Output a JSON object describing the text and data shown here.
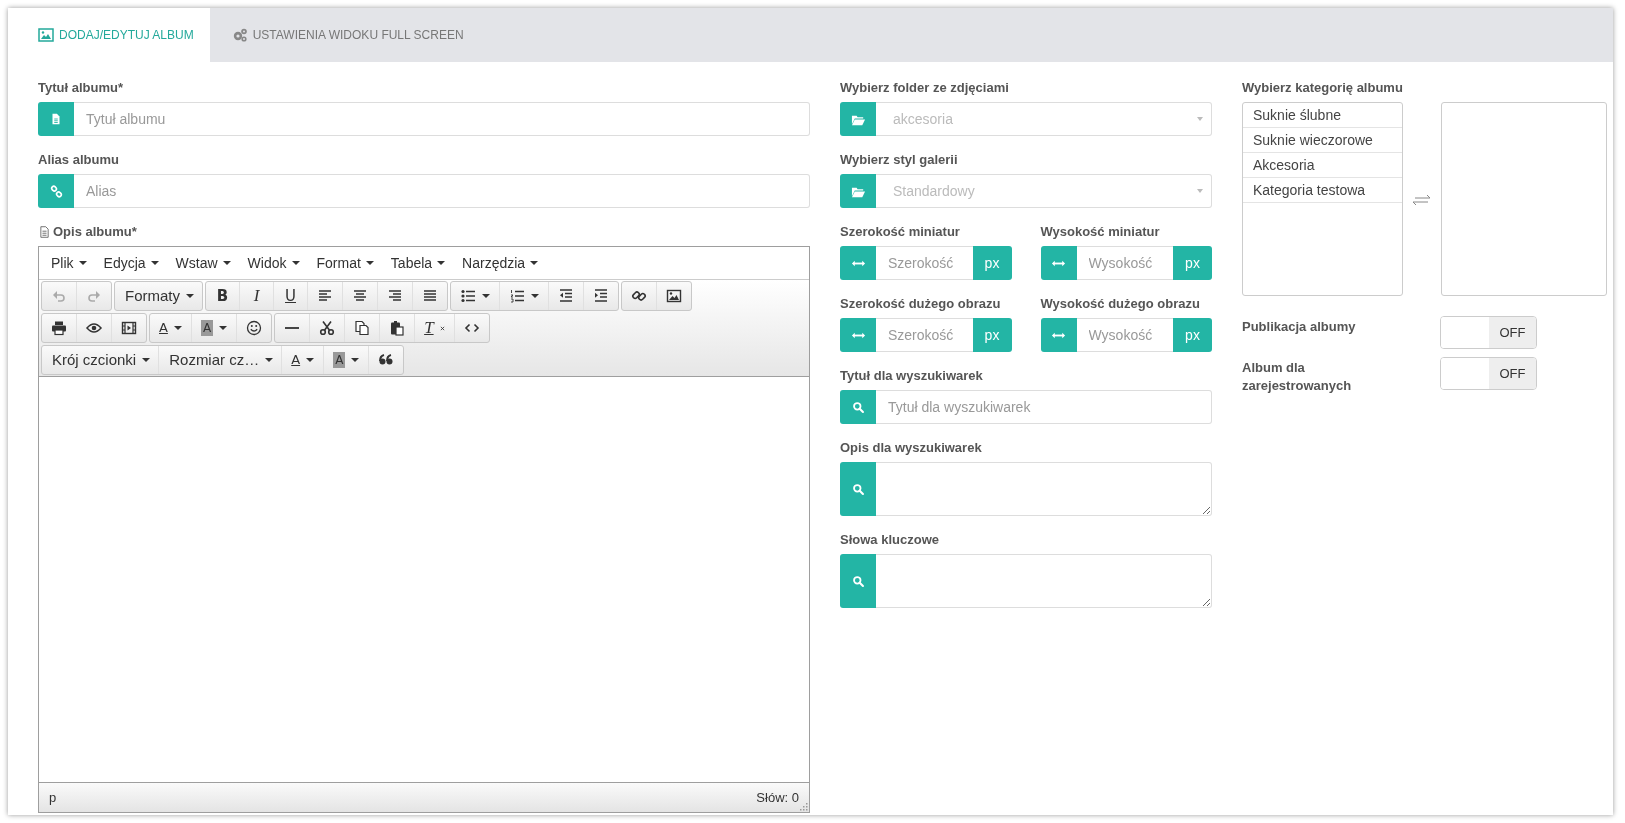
{
  "tabs": [
    {
      "label": "DODAJ/EDYTUJ ALBUM",
      "selected": true
    },
    {
      "label": "USTAWIENIA WIDOKU FULL SCREEN",
      "selected": false
    }
  ],
  "left": {
    "fields": [
      {
        "label": "Tytuł albumu*",
        "placeholder": "Tytuł albumu"
      },
      {
        "label": "Alias albumu",
        "placeholder": "Alias"
      }
    ],
    "editor": {
      "label": "Opis albumu*",
      "menu": [
        "Plik",
        "Edycja",
        "Wstaw",
        "Widok",
        "Format",
        "Tabela",
        "Narzędzia"
      ],
      "toolbar": [
        [
          [
            {
              "kind": "undo",
              "disabled": true
            },
            {
              "kind": "redo",
              "disabled": true
            }
          ],
          [
            {
              "kind": "dropdown",
              "text": "Formaty",
              "disabled": false
            }
          ],
          [
            {
              "kind": "bold",
              "text": "B",
              "disabled": false
            },
            {
              "kind": "italic",
              "text": "I",
              "disabled": false
            },
            {
              "kind": "underline",
              "text": "U",
              "disabled": false
            },
            {
              "kind": "align-left",
              "disabled": false
            },
            {
              "kind": "align-center",
              "disabled": false
            },
            {
              "kind": "align-right",
              "disabled": false
            },
            {
              "kind": "justify",
              "disabled": false
            }
          ],
          [
            {
              "kind": "bullet-list",
              "disabled": false
            },
            {
              "kind": "numbered-list",
              "disabled": false
            },
            {
              "kind": "outdent",
              "disabled": false
            },
            {
              "kind": "indent",
              "disabled": false
            }
          ],
          [
            {
              "kind": "link",
              "disabled": false
            },
            {
              "kind": "image",
              "disabled": false
            }
          ]
        ],
        [
          [
            {
              "kind": "print",
              "disabled": false
            },
            {
              "kind": "preview",
              "disabled": false
            },
            {
              "kind": "media",
              "disabled": false
            }
          ],
          [
            {
              "kind": "text-color",
              "text": "A",
              "disabled": false
            },
            {
              "kind": "background-color",
              "text": "A",
              "disabled": false
            },
            {
              "kind": "emoticon",
              "disabled": false
            }
          ],
          [
            {
              "kind": "horizontal-rule",
              "disabled": false
            },
            {
              "kind": "cut",
              "disabled": false
            },
            {
              "kind": "copy",
              "disabled": false
            },
            {
              "kind": "paste",
              "disabled": false
            },
            {
              "kind": "clear-format",
              "text": "T",
              "disabled": false
            },
            {
              "kind": "source-code",
              "disabled": false
            }
          ]
        ],
        [
          [
            {
              "kind": "dropdown",
              "text": "Krój czcionki",
              "disabled": false
            },
            {
              "kind": "dropdown",
              "text": "Rozmiar cz…",
              "disabled": false
            },
            {
              "kind": "text-color",
              "text": "A",
              "disabled": false
            },
            {
              "kind": "background-color",
              "text": "A",
              "disabled": false
            },
            {
              "kind": "blockquote",
              "disabled": false
            }
          ]
        ]
      ],
      "status_path": "p",
      "word_count": "Słów: 0"
    }
  },
  "middle": [
    {
      "kind": "select",
      "label": "Wybierz folder ze zdjęciami",
      "value": "akcesoria"
    },
    {
      "kind": "select",
      "label": "Wybierz styl galerii",
      "value": "Standardowy"
    },
    {
      "kind": "pair",
      "items": [
        {
          "label": "Szerokość miniatur",
          "placeholder": "Szerokość",
          "unit": "px"
        },
        {
          "label": "Wysokość miniatur",
          "placeholder": "Wysokość",
          "unit": "px"
        }
      ]
    },
    {
      "kind": "pair",
      "items": [
        {
          "label": "Szerokość dużego obrazu",
          "placeholder": "Szerokość",
          "unit": "px"
        },
        {
          "label": "Wysokość dużego obrazu",
          "placeholder": "Wysokość",
          "unit": "px"
        }
      ]
    },
    {
      "kind": "search",
      "label": "Tytuł dla wyszukiwarek",
      "placeholder": "Tytuł dla wyszukiwarek"
    },
    {
      "kind": "search-area",
      "label": "Opis dla wyszukiwarek"
    },
    {
      "kind": "search-area",
      "label": "Słowa kluczowe"
    }
  ],
  "right": {
    "category": {
      "label": "Wybierz kategorię albumu",
      "available": [
        "Suknie ślubne",
        "Suknie wieczorowe",
        "Akcesoria",
        "Kategoria testowa"
      ]
    },
    "toggles": [
      {
        "label": "Publikacja albumy",
        "on": false,
        "text": "OFF"
      },
      {
        "label": "Album dla zarejestrowanych",
        "on": false,
        "text": "OFF"
      }
    ]
  }
}
